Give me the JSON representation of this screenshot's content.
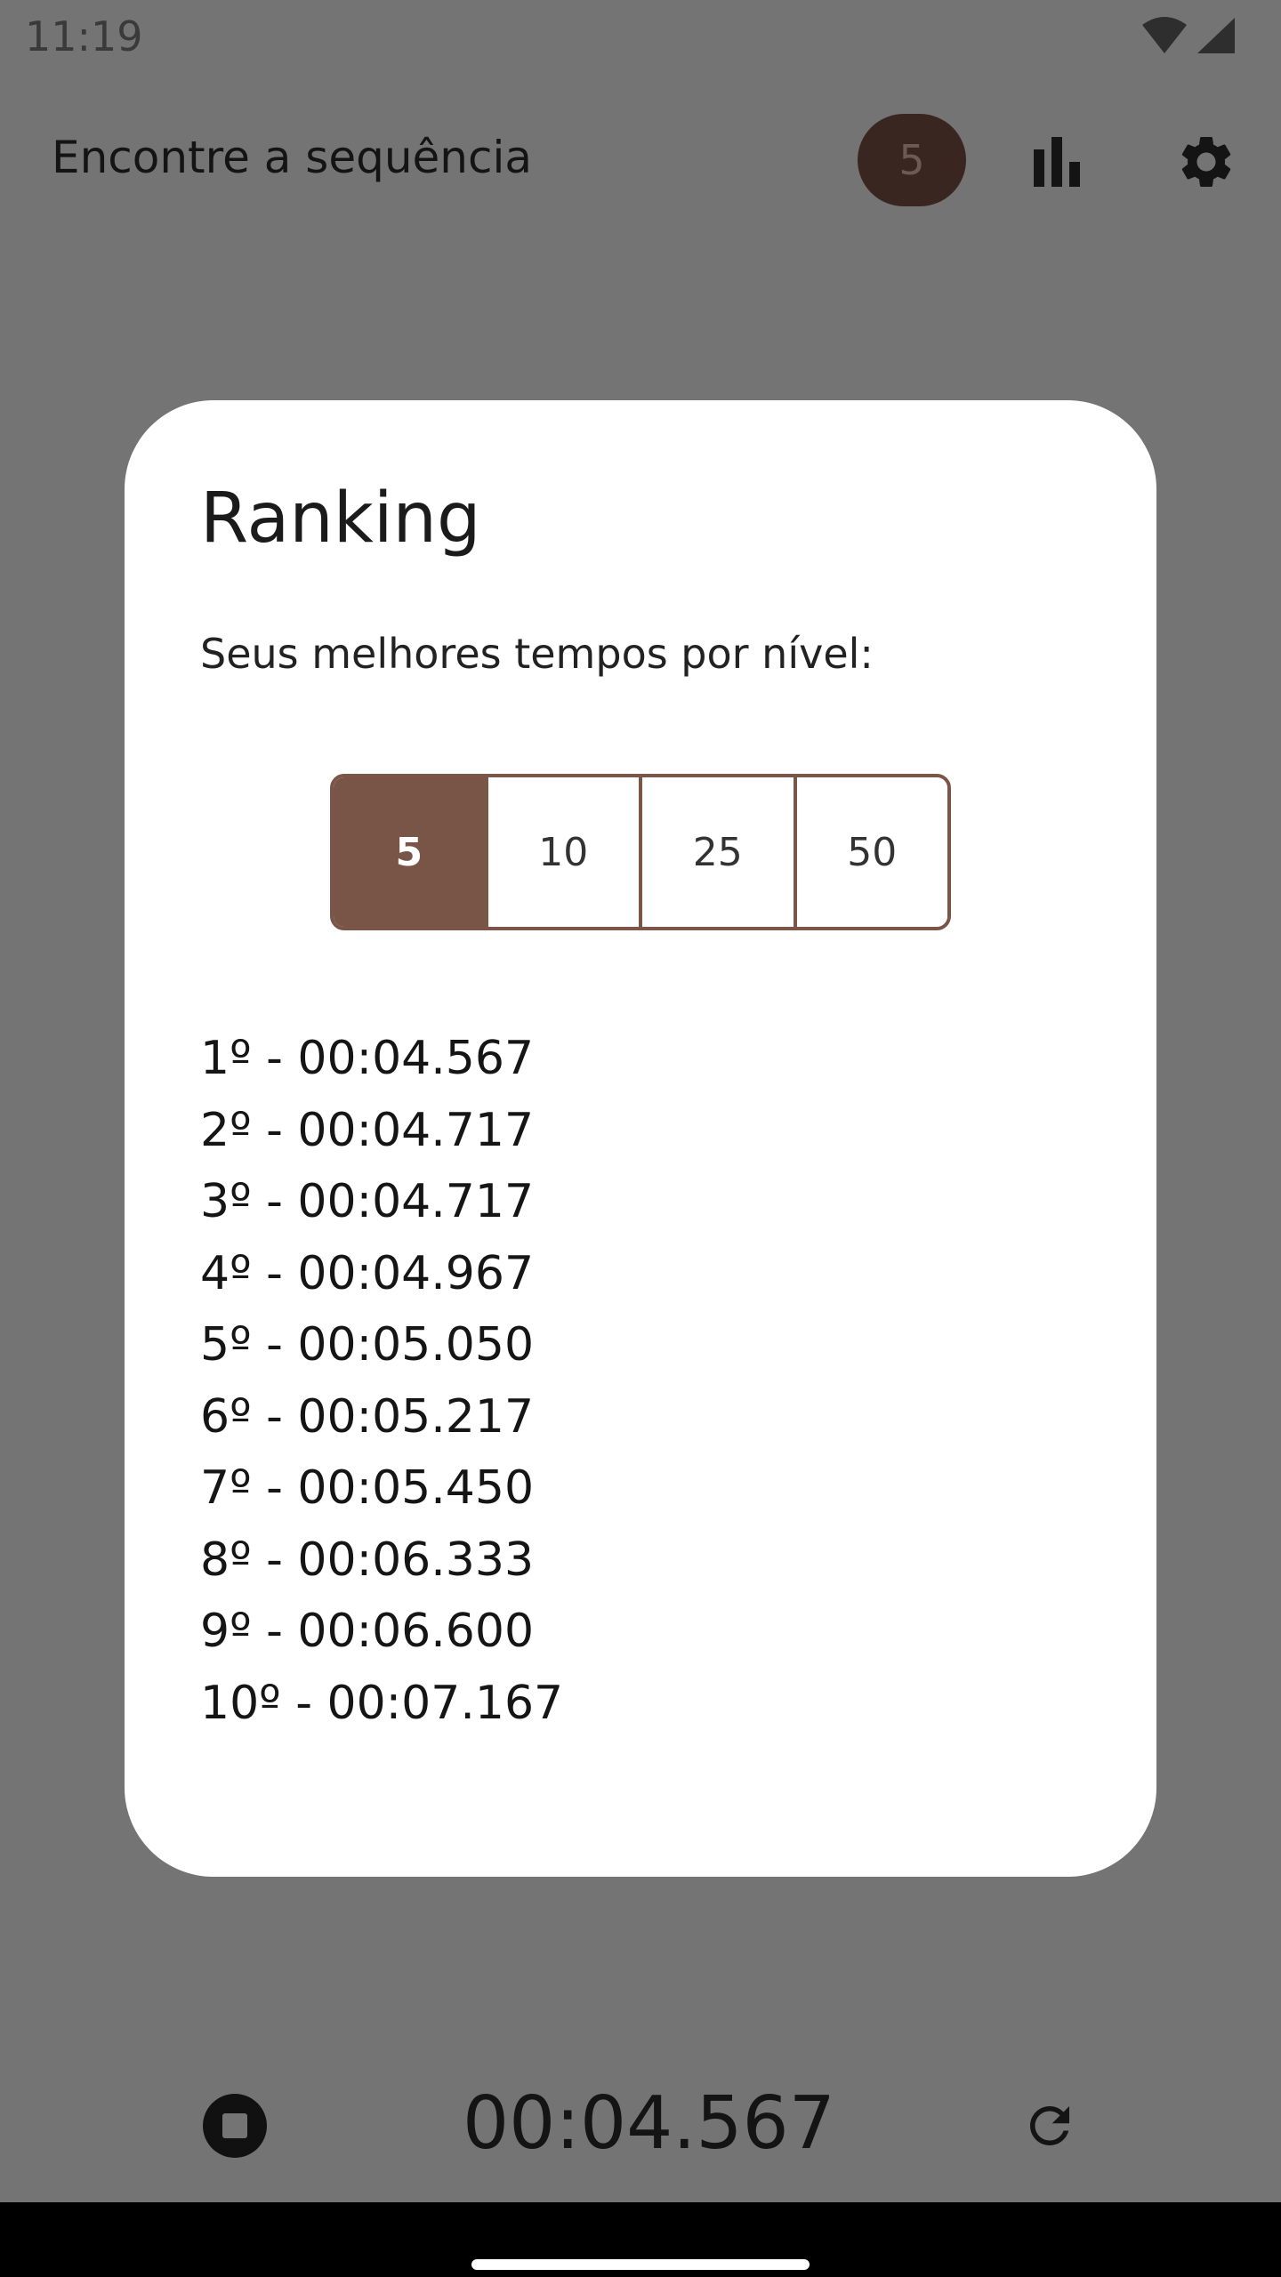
{
  "status_bar": {
    "time": "11:19",
    "icons": [
      "wifi-icon",
      "signal-icon"
    ]
  },
  "app_bar": {
    "title": "Encontre a sequência",
    "level_badge": "5",
    "icons": [
      "bar-chart-icon",
      "gear-icon"
    ]
  },
  "dialog": {
    "title": "Ranking",
    "subtitle": "Seus melhores tempos por nível:",
    "levels": [
      "5",
      "10",
      "25",
      "50"
    ],
    "selected_level": "5",
    "ranking": [
      "1º - 00:04.567",
      "2º - 00:04.717",
      "3º - 00:04.717",
      "4º - 00:04.967",
      "5º - 00:05.050",
      "6º - 00:05.217",
      "7º - 00:05.450",
      "8º - 00:06.333",
      "9º - 00:06.600",
      "10º - 00:07.167"
    ]
  },
  "bottom_bar": {
    "timer": "00:04.567",
    "icons": [
      "stop-icon",
      "refresh-icon"
    ]
  },
  "colors": {
    "accent": "#795548",
    "badge_bg": "#3a2621",
    "scrim": "#747474",
    "dialog_bg": "#ffffff"
  }
}
